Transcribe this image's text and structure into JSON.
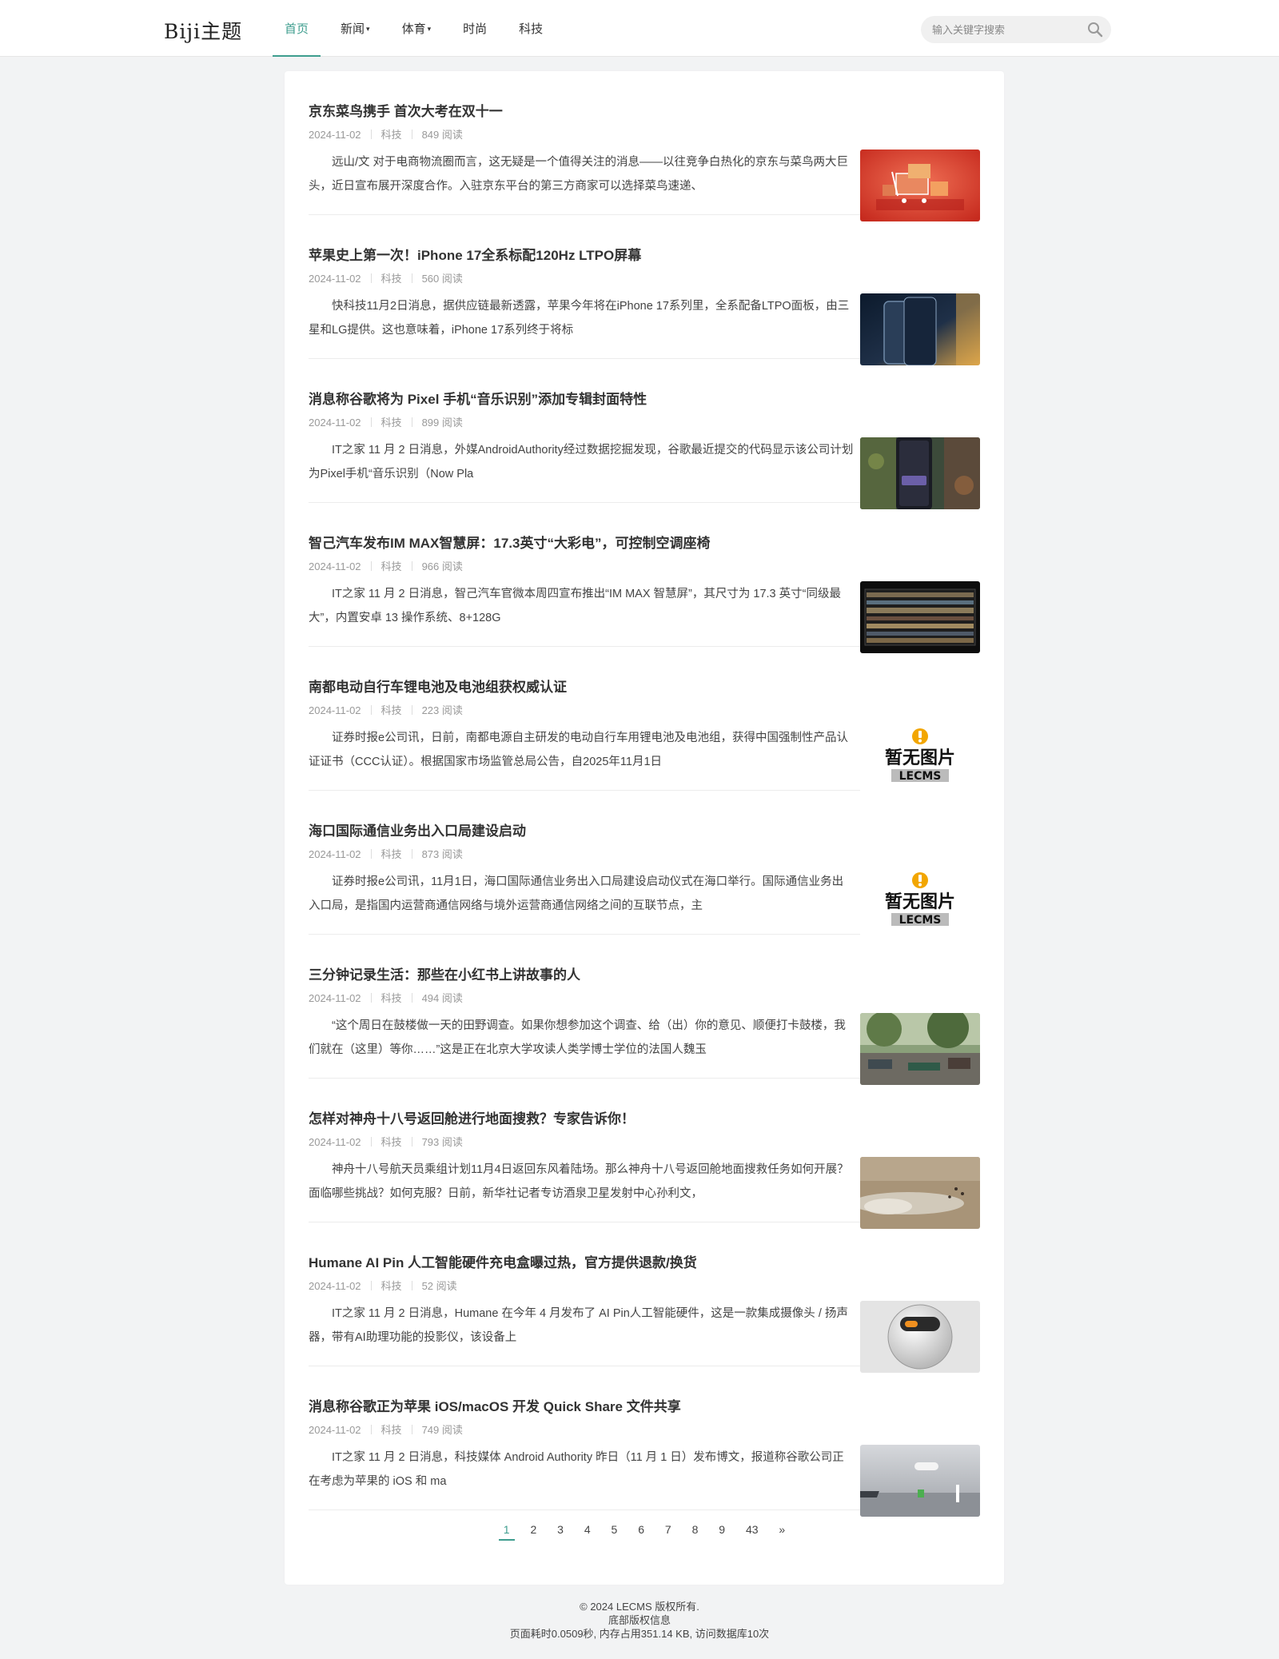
{
  "header": {
    "logo": "Biji主题",
    "nav": [
      {
        "label": "首页",
        "caret": ""
      },
      {
        "label": "新闻",
        "caret": "▾"
      },
      {
        "label": "体育",
        "caret": "▾"
      },
      {
        "label": "时尚",
        "caret": ""
      },
      {
        "label": "科技",
        "caret": ""
      }
    ],
    "search_placeholder": "输入关键字搜索"
  },
  "articles": [
    {
      "title": "京东菜鸟携手 首次大考在双十一",
      "date": "2024-11-02",
      "category": "科技",
      "views": "849 阅读",
      "excerpt": "远山/文 对于电商物流圈而言，这无疑是一个值得关注的消息——以往竞争白热化的京东与菜鸟两大巨头，近日宣布展开深度合作。入驻京东平台的第三方商家可以选择菜鸟速递、",
      "thumb": "shopping-cart-photo"
    },
    {
      "title": "苹果史上第一次！iPhone 17全系标配120Hz LTPO屏幕",
      "date": "2024-11-02",
      "category": "科技",
      "views": "560 阅读",
      "excerpt": "快科技11月2日消息，据供应链最新透露，苹果今年将在iPhone 17系列里，全系配备LTPO面板，由三星和LG提供。这也意味着，iPhone 17系列终于将标",
      "thumb": "iphone-photo"
    },
    {
      "title": "消息称谷歌将为 Pixel 手机“音乐识别”添加专辑封面特性",
      "date": "2024-11-02",
      "category": "科技",
      "views": "899 阅读",
      "excerpt": "IT之家 11 月 2 日消息，外媒AndroidAuthority经过数据挖掘发现，谷歌最近提交的代码显示该公司计划为Pixel手机“音乐识别（Now Pla",
      "thumb": "pixel-phone-photo"
    },
    {
      "title": "智己汽车发布IM MAX智慧屏：17.3英寸“大彩电”，可控制空调座椅",
      "date": "2024-11-02",
      "category": "科技",
      "views": "966 阅读",
      "excerpt": "IT之家 11 月 2 日消息，智己汽车官微本周四宣布推出“IM MAX 智慧屏”，其尺寸为 17.3 英寸“同级最大”，内置安卓 13 操作系统、8+128G",
      "thumb": "car-screen-photo"
    },
    {
      "title": "南都电动自行车锂电池及电池组获权威认证",
      "date": "2024-11-02",
      "category": "科技",
      "views": "223 阅读",
      "excerpt": "证券时报e公司讯，日前，南都电源自主研发的电动自行车用锂电池及电池组，获得中国强制性产品认证证书（CCC认证）。根据国家市场监管总局公告，自2025年11月1日",
      "thumb": "no-image"
    },
    {
      "title": "海口国际通信业务出入口局建设启动",
      "date": "2024-11-02",
      "category": "科技",
      "views": "873 阅读",
      "excerpt": "证券时报e公司讯，11月1日，海口国际通信业务出入口局建设启动仪式在海口举行。国际通信业务出入口局，是指国内运营商通信网络与境外运营商通信网络之间的互联节点，主",
      "thumb": "no-image"
    },
    {
      "title": "三分钟记录生活：那些在小红书上讲故事的人",
      "date": "2024-11-02",
      "category": "科技",
      "views": "494 阅读",
      "excerpt": "“这个周日在鼓楼做一天的田野调查。如果你想参加这个调查、给（出）你的意见、顺便打卡鼓楼，我们就在（这里）等你……”这是正在北京大学攻读人类学博士学位的法国人魏玉",
      "thumb": "street-photo"
    },
    {
      "title": "怎样对神舟十八号返回舱进行地面搜救？专家告诉你！",
      "date": "2024-11-02",
      "category": "科技",
      "views": "793 阅读",
      "excerpt": "神舟十八号航天员乘组计划11月4日返回东风着陆场。那么神舟十八号返回舱地面搜救任务如何开展？面临哪些挑战？如何克服？日前，新华社记者专访酒泉卫星发射中心孙利文，",
      "thumb": "desert-photo"
    },
    {
      "title": "Humane AI Pin 人工智能硬件充电盒曝过热，官方提供退款/换货",
      "date": "2024-11-02",
      "category": "科技",
      "views": "52 阅读",
      "excerpt": "IT之家 11 月 2 日消息，Humane 在今年 4 月发布了 AI Pin人工智能硬件，这是一款集成摄像头 / 扬声器，带有AI助理功能的投影仪，该设备上",
      "thumb": "ai-pin-photo"
    },
    {
      "title": "消息称谷歌正为苹果 iOS/macOS 开发 Quick Share 文件共享",
      "date": "2024-11-02",
      "category": "科技",
      "views": "749 阅读",
      "excerpt": "IT之家 11 月 2 日消息，科技媒体 Android Authority 昨日（11 月 1 日）发布博文，报道称谷歌公司正在考虑为苹果的 iOS 和 ma",
      "thumb": "quick-share-photo"
    }
  ],
  "no_image": {
    "cn": "暂无图片",
    "brand": "LECMS"
  },
  "pagination": [
    "1",
    "2",
    "3",
    "4",
    "5",
    "6",
    "7",
    "8",
    "9",
    "43",
    "»"
  ],
  "footer": {
    "copyright": "© 2024 LECMS 版权所有.",
    "line2": "底部版权信息",
    "stats": "页面耗时0.0509秒, 内存占用351.14 KB, 访问数据库10次"
  },
  "colors": {
    "accent": "#3e9d8e",
    "page_bg": "#f2f3f4"
  }
}
